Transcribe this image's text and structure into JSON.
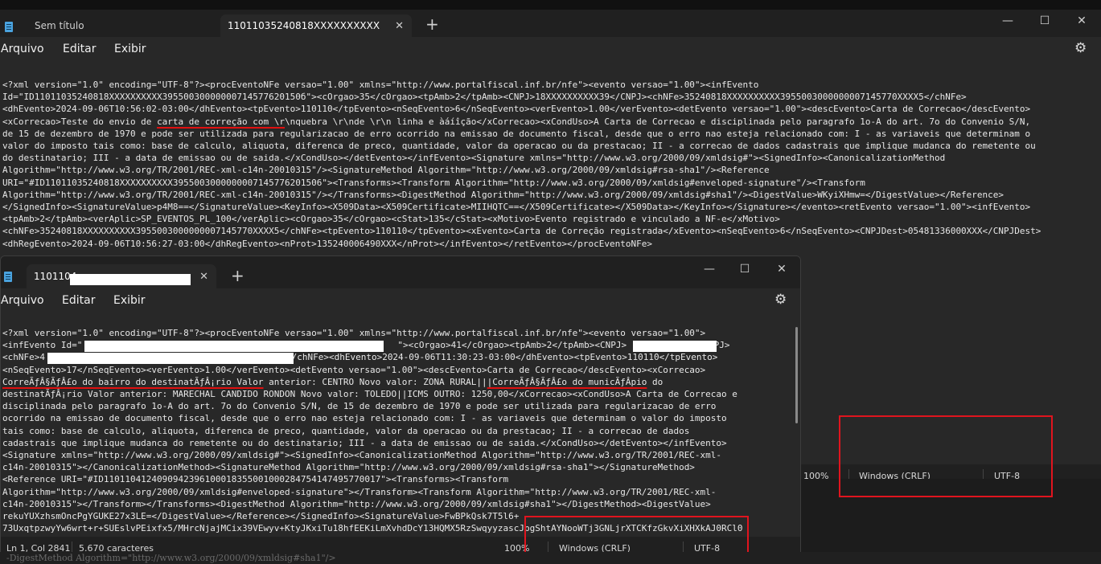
{
  "win1": {
    "tabs": [
      {
        "label": "Sem título"
      },
      {
        "label": "11011035240818XXXXXXXXXX3955",
        "close": "✕"
      }
    ],
    "new_tab": "+",
    "controls": {
      "minimize": "—",
      "maximize": "☐",
      "close": "✕"
    },
    "menu": {
      "file": "Arquivo",
      "edit": "Editar",
      "view": "Exibir"
    },
    "gear": "⚙",
    "lines": [
      "<?xml version=\"1.0\" encoding=\"UTF-8\"?><procEventoNFe versao=\"1.00\" xmlns=\"http://www.portalfiscal.inf.br/nfe\"><evento versao=\"1.00\"><infEvento",
      "Id=\"ID11011035240818XXXXXXXXXX39550030000000714577620150б\"><cOrgao>35</cOrgao><tpAmb>2</tpAmb><CNPJ>18XXXXXXXXXX39</CNPJ><chNFe>35240818XXXXXXXXXX3955003000000007145770XXXX5</chNFe>",
      "<dhEvento>2024-09-06T10:56:02-03:00</dhEvento><tpEvento>110110</tpEvento><nSeqEvento>6</nSeqEvento><verEvento>1.00</verEvento><detEvento versao=\"1.00\"><descEvento>Carta de Correcao</descEvento>",
      "<xCorrecao>Teste do envio de ",
      "carta de correção com \\r",
      "\\nquebra \\r\\nde \\r\\n linha e àáíîção</xCorrecao><xCondUso>A Carta de Correcao e disciplinada pelo paragrafo 1o-A do art. 7o do Convenio S/N,",
      "de 15 de dezembro de 1970 e pode ser utilizada para regularizacao de erro ocorrido na emissao de documento fiscal, desde que o erro nao esteja relacionado com: I - as variaveis que determinam o",
      "valor do imposto tais como: base de calculo, aliquota, diferenca de preco, quantidade, valor da operacao ou da prestacao; II - a correcao de dados cadastrais que implique mudanca do remetente ou",
      "do destinatario; III - a data de emissao ou de saida.</xCondUso></detEvento></infEvento><Signature xmlns=\"http://www.w3.org/2000/09/xmldsig#\"><SignedInfo><CanonicalizationMethod",
      "Algorithm=\"http://www.w3.org/TR/2001/REC-xml-c14n-20010315\"/><SignatureMethod Algorithm=\"http://www.w3.org/2000/09/xmldsig#rsa-sha1\"/><Reference",
      "URI=\"#ID11011035240818XXXXXXXXXX3955003000000007145776201506\"><Transforms><Transform Algorithm=\"http://www.w3.org/2000/09/xmldsig#enveloped-signature\"/><Transform",
      "Algorithm=\"http://www.w3.org/TR/2001/REC-xml-c14n-20010315\"/></Transforms><DigestMethod Algorithm=\"http://www.w3.org/2000/09/xmldsig#sha1\"/><DigestValue>WKyiXHmw=</DigestValue></Reference>",
      "</SignedInfo><SignatureValue>p4M8==</SignatureValue><KeyInfo><X509Data><X509Certificate>MIIHQTC==</X509Certificate></X509Data></KeyInfo></Signature></evento><retEvento versao=\"1.00\"><infEvento>",
      "<tpAmb>2</tpAmb><verAplic>SP_EVENTOS_PL_100</verAplic><cOrgao>35</cOrgao><cStat>135</cStat><xMotivo>Evento registrado e vinculado a NF-e</xMotivo>",
      "<chNFe>35240818XXXXXXXXXX3955003000000007145770XXXX5</chNFe><tpEvento>110110</tpEvento><xEvento>Carta de Correção registrada</xEvento><nSeqEvento>6</nSeqEvento><CNPJDest>05481336000XXX</CNPJDest>",
      "<dhRegEvento>2024-09-06T10:56:27-03:00</dhRegEvento><nProt>135240006490XXX</nProt></infEvento></retEvento></procEventoNFe>"
    ],
    "status": {
      "zoom": "100%",
      "eol": "Windows (CRLF)",
      "encoding": "UTF-8"
    }
  },
  "win2": {
    "tabs": [
      {
        "label": "1101104",
        "close": "✕"
      }
    ],
    "new_tab": "+",
    "controls": {
      "minimize": "—",
      "maximize": "☐",
      "close": "✕"
    },
    "menu": {
      "file": "Arquivo",
      "edit": "Editar",
      "view": "Exibir"
    },
    "gear": "⚙",
    "lines": [
      "<?xml version=\"1.0\" encoding=\"UTF-8\"?><procEventoNFe versao=\"1.00\" xmlns=\"http://www.portalfiscal.inf.br/nfe\"><evento versao=\"1.00\">",
      "<infEvento Id=\"",
      "\"><cOrgao>41</cOrgao><tpAmb>2</tpAmb><CNPJ>",
      "</CNPJ>",
      "<chNFe>4",
      "</chNFe><dhEvento>2024-09-06T11:30:23-03:00</dhEvento><tpEvento>110110</tpEvento>",
      "<nSeqEvento>17</nSeqEvento><verEvento>1.00</verEvento><detEvento versao=\"1.00\"><descEvento>Carta de Correcao</descEvento><xCorrecao>",
      "CorreÃƒÂ§ÃƒÂ£o do bairro do destinatÃƒÂ¡rio Valor",
      " anterior: CENTRO Novo valor: ZONA RURAL||",
      "|CorreÃƒÂ§ÃƒÂ£o do municÃƒÂ­pio",
      " do",
      "destinatÃƒÂ¡rio Valor anterior: MARECHAL CANDIDO RONDON Novo valor: TOLEDO||ICMS OUTRO: 1250,00</xCorrecao><xCondUso>A Carta de Correcao e",
      "disciplinada pelo paragrafo 1o-A do art. 7o do Convenio S/N, de 15 de dezembro de 1970 e pode ser utilizada para regularizacao de erro",
      "ocorrido na emissao de documento fiscal, desde que o erro nao esteja relacionado com: I - as variaveis que determinam o valor do imposto",
      "tais como: base de calculo, aliquota, diferenca de preco, quantidade, valor da operacao ou da prestacao; II - a correcao de dados",
      "cadastrais que implique mudanca do remetente ou do destinatario; III - a data de emissao ou de saida.</xCondUso></detEvento></infEvento>",
      "<Signature xmlns=\"http://www.w3.org/2000/09/xmldsig#\"><SignedInfo><CanonicalizationMethod Algorithm=\"http://www.w3.org/TR/2001/REC-xml-",
      "c14n-20010315\"></CanonicalizationMethod><SignatureMethod Algorithm=\"http://www.w3.org/2000/09/xmldsig#rsa-sha1\"></SignatureMethod>",
      "<Reference URI=\"#ID1101104124090942396100018355001000284754147495770017\"><Transforms><Transform",
      "Algorithm=\"http://www.w3.org/2000/09/xmldsig#enveloped-signature\"></Transform><Transform Algorithm=\"http://www.w3.org/TR/2001/REC-xml-",
      "c14n-20010315\"></Transform></Transforms><DigestMethod Algorithm=\"http://www.w3.org/2000/09/xmldsig#sha1\"></DigestMethod><DigestValue>",
      "rekuYUXzhsmOncPgYGUKE27x3LE=</DigestValue></Reference></SignedInfo><SignatureValue>FwBPkQsk7T5l6+",
      "73UxqtpzwyYw6wrt+r+SUEslvPEixfx5/MHrcNjajMCix39VEwyv+KtyJKxiTu18hfEEKiLmXvhdDcY13HQMX5RzSwqyyzascJpgShtAYNooWTj3GNLjrXTCKfzGkvXiXHXkAJ0RCl0"
    ],
    "status": {
      "position": "Ln 1, Col 2841",
      "chars": "5.670 caracteres",
      "zoom": "100%",
      "eol": "Windows (CRLF)",
      "encoding": "UTF-8"
    }
  },
  "peek": "-DigestMethod Algorithm=\"http://www.w3.org/2000/09/xmldsig#sha1\"/>"
}
